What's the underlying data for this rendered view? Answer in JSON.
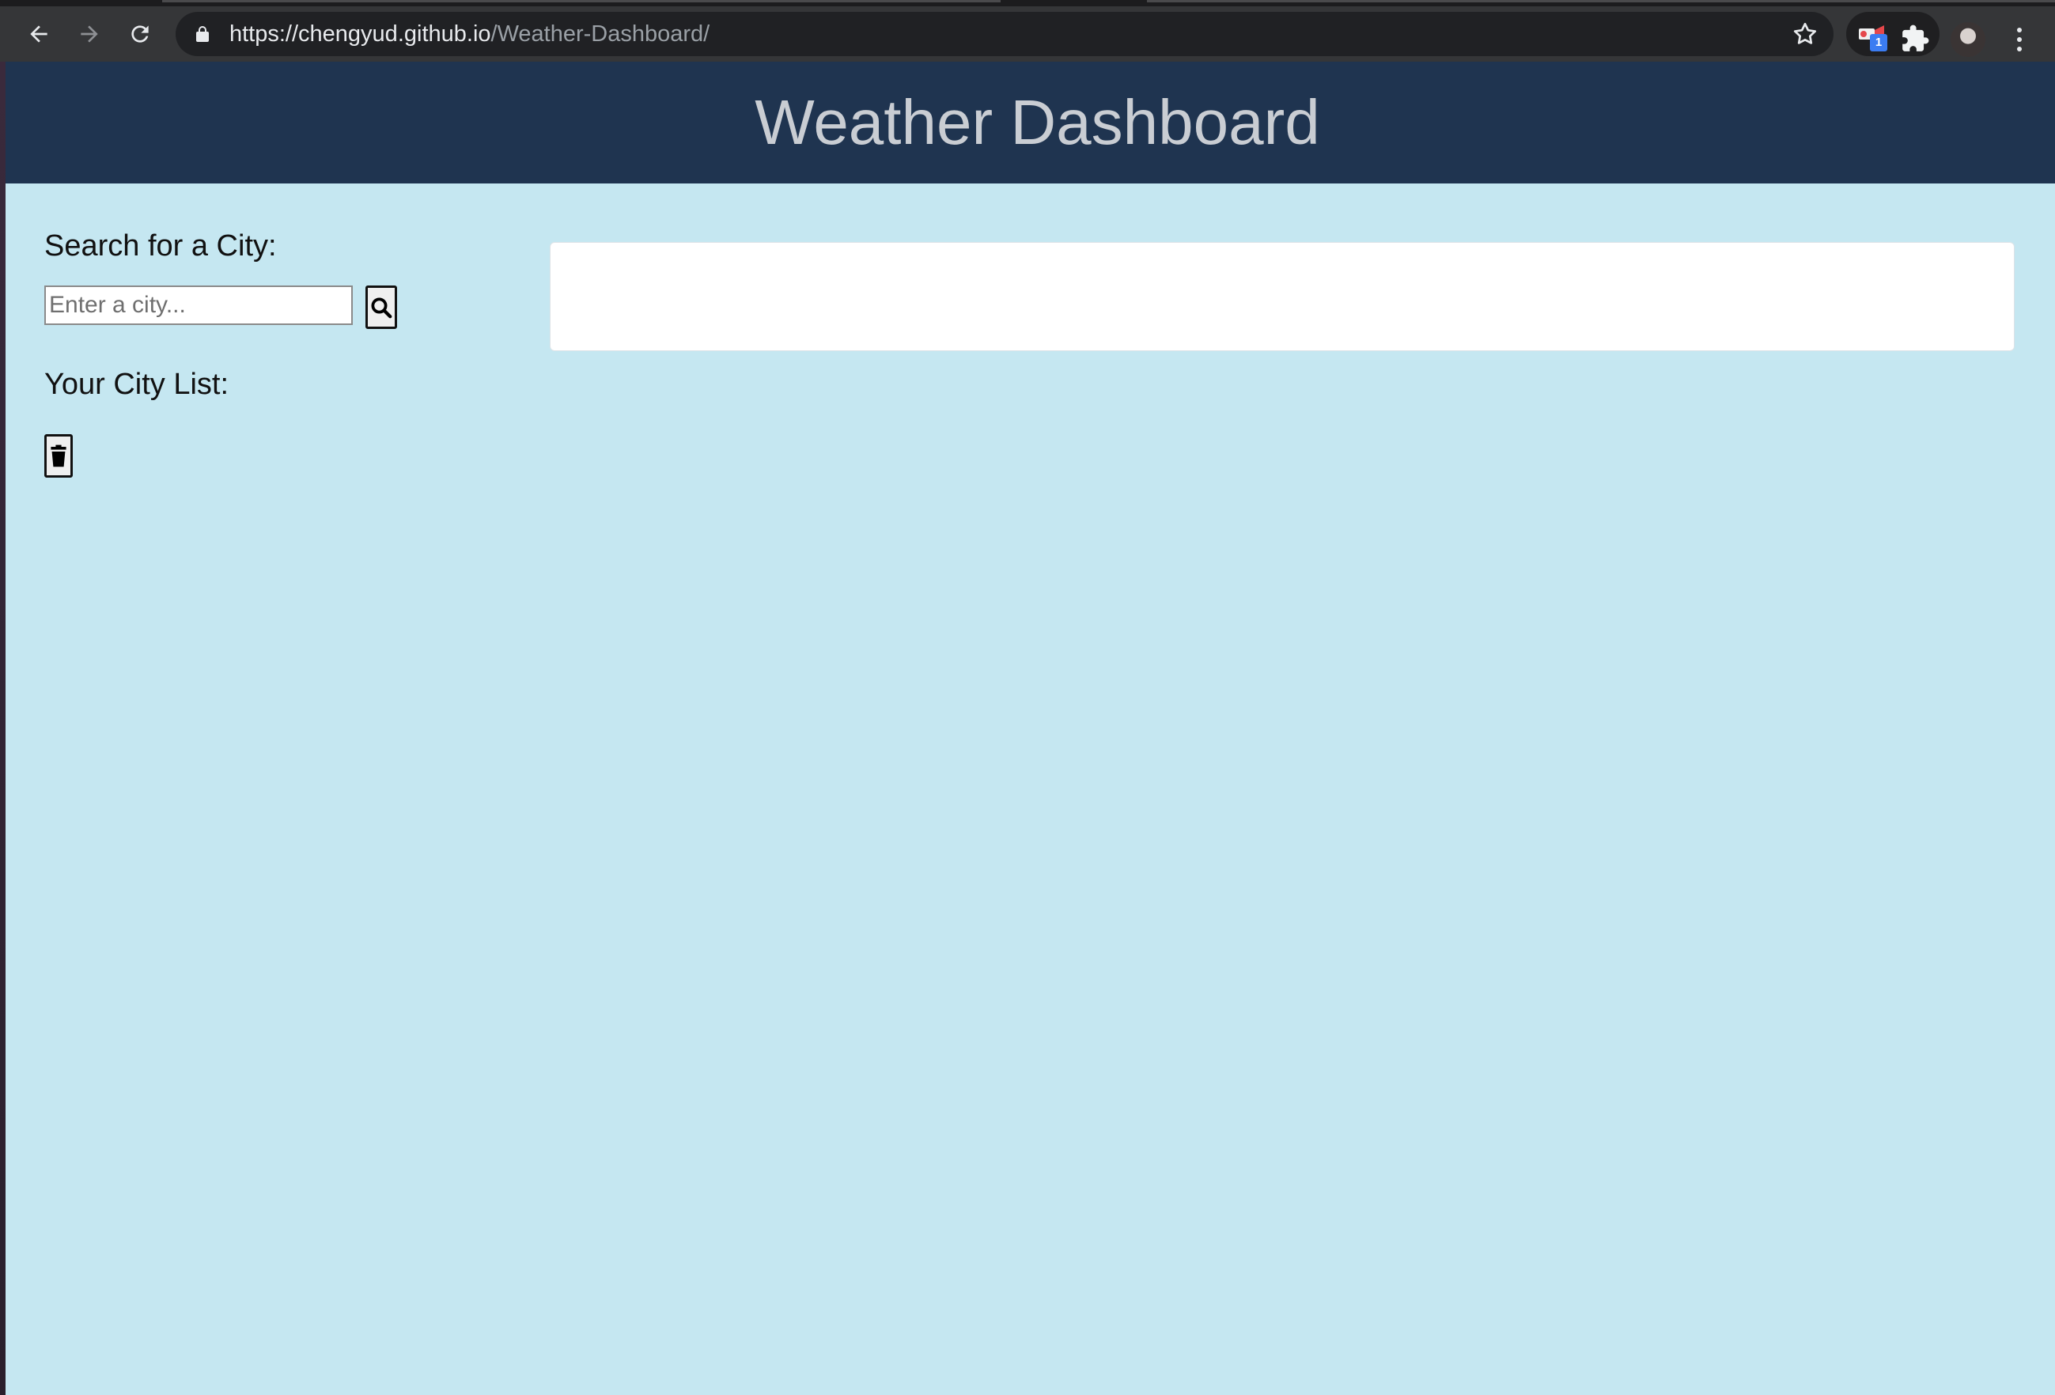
{
  "browser": {
    "url_host": "https://chengyud.github.io",
    "url_path": "/Weather-Dashboard/",
    "extension_badge": "1"
  },
  "page": {
    "title": "Weather Dashboard",
    "search": {
      "label": "Search for a City:",
      "placeholder": "Enter a city...",
      "value": ""
    },
    "city_list": {
      "label": "Your City List:",
      "items": []
    },
    "colors": {
      "header_bg": "#1f3450",
      "page_bg": "#c5e7f1",
      "title_text": "#c9cdd3"
    }
  }
}
